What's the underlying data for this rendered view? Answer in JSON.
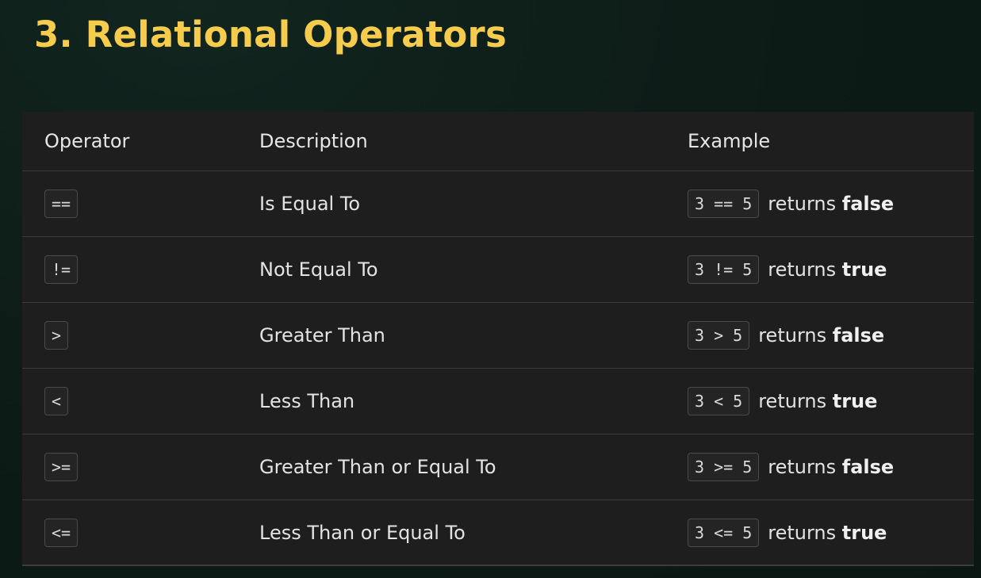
{
  "title": "3. Relational Operators",
  "table": {
    "headers": {
      "operator": "Operator",
      "description": "Description",
      "example": "Example"
    },
    "rows": [
      {
        "operator": "==",
        "description": "Is Equal To",
        "example_code": "3 == 5",
        "example_prefix": "returns",
        "example_result": "false"
      },
      {
        "operator": "!=",
        "description": "Not Equal To",
        "example_code": "3 != 5",
        "example_prefix": "returns",
        "example_result": "true"
      },
      {
        "operator": ">",
        "description": "Greater Than",
        "example_code": "3 > 5",
        "example_prefix": "returns",
        "example_result": "false"
      },
      {
        "operator": "<",
        "description": "Less Than",
        "example_code": "3 < 5",
        "example_prefix": "returns",
        "example_result": "true"
      },
      {
        "operator": ">=",
        "description": "Greater Than or Equal To",
        "example_code": "3 >= 5",
        "example_prefix": "returns",
        "example_result": "false"
      },
      {
        "operator": "<=",
        "description": "Less Than or Equal To",
        "example_code": "3 <= 5",
        "example_prefix": "returns",
        "example_result": "true"
      }
    ]
  },
  "colors": {
    "title": "#f5cc4c",
    "background": "#0f1f1a",
    "table_background": "#1e1e1e"
  }
}
